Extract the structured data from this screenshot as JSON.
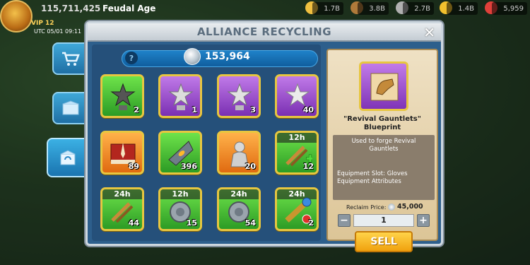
{
  "topbar": {
    "power": "115,711,425",
    "age": "Feudal Age",
    "vip": "VIP 12",
    "utc": "UTC 05/01 09:11",
    "resources": [
      {
        "value": "1.7B",
        "icon": "food-icon",
        "color": "#f0c040"
      },
      {
        "value": "3.8B",
        "icon": "wood-icon",
        "color": "#b07a3a"
      },
      {
        "value": "2.7B",
        "icon": "stone-icon",
        "color": "#b0b0b0"
      },
      {
        "value": "1.4B",
        "icon": "gold-icon",
        "color": "#f2c12e"
      },
      {
        "value": "5,959",
        "icon": "gem-icon",
        "color": "#e0403a"
      }
    ]
  },
  "tabs": [
    {
      "name": "shop-tab",
      "icon": "cart-icon"
    },
    {
      "name": "mail-tab",
      "icon": "box-icon"
    },
    {
      "name": "recycling-tab",
      "icon": "recycle-box-icon",
      "active": true
    }
  ],
  "panel": {
    "title": "ALLIANCE RECYCLING",
    "close": "✕",
    "silver": {
      "help": "?",
      "value": "153,964"
    }
  },
  "items": [
    {
      "name": "dark-star-trophy",
      "count": "2",
      "bg": "green"
    },
    {
      "name": "silver-star-trophy",
      "count": "1",
      "bg": "purple"
    },
    {
      "name": "silver-star-trophy-2",
      "count": "3",
      "bg": "purple"
    },
    {
      "name": "silver-star",
      "count": "40",
      "bg": "purple"
    },
    {
      "name": "banner-book",
      "count": "89",
      "bg": "orange"
    },
    {
      "name": "gem-shard",
      "count": "396",
      "bg": "green"
    },
    {
      "name": "statue",
      "count": "20",
      "bg": "orange"
    },
    {
      "name": "speedup-12h",
      "count": "12",
      "bg": "green",
      "timer": "12h"
    },
    {
      "name": "speedup-24h",
      "count": "44",
      "bg": "green",
      "timer": "24h"
    },
    {
      "name": "shield-12h",
      "count": "15",
      "bg": "green",
      "timer": "12h"
    },
    {
      "name": "shield-24h",
      "count": "54",
      "bg": "green",
      "timer": "24h"
    },
    {
      "name": "scope-24h",
      "count": "2",
      "bg": "green",
      "timer": "24h"
    }
  ],
  "detail": {
    "name_line1": "\"Revival Gauntlets\"",
    "name_line2": "Blueprint",
    "desc": "Used to forge Revival Gauntlets",
    "slot": "Equipment Slot: Gloves",
    "attrs": "Equipment Attributes",
    "reclaim_label": "Reclaim Price:",
    "reclaim_value": "45,000",
    "qty_minus": "−",
    "qty_plus": "+",
    "quantity": "1",
    "sell": "SELL"
  }
}
